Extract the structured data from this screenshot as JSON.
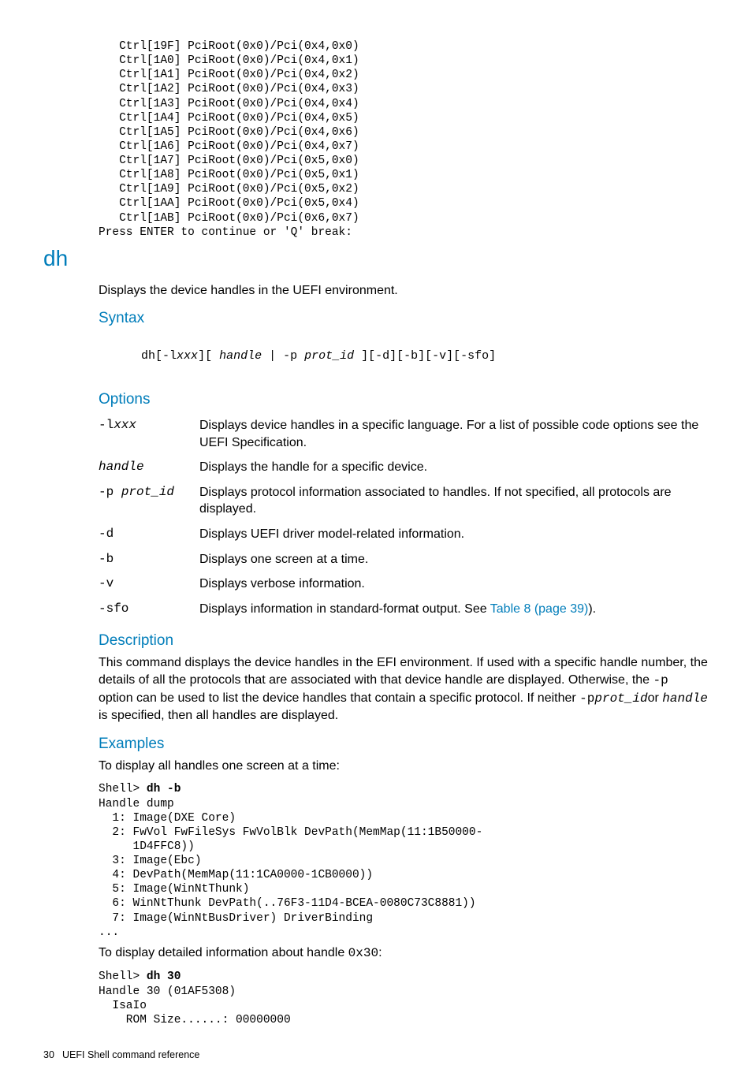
{
  "top_code": "   Ctrl[19F] PciRoot(0x0)/Pci(0x4,0x0)\n   Ctrl[1A0] PciRoot(0x0)/Pci(0x4,0x1)\n   Ctrl[1A1] PciRoot(0x0)/Pci(0x4,0x2)\n   Ctrl[1A2] PciRoot(0x0)/Pci(0x4,0x3)\n   Ctrl[1A3] PciRoot(0x0)/Pci(0x4,0x4)\n   Ctrl[1A4] PciRoot(0x0)/Pci(0x4,0x5)\n   Ctrl[1A5] PciRoot(0x0)/Pci(0x4,0x6)\n   Ctrl[1A6] PciRoot(0x0)/Pci(0x4,0x7)\n   Ctrl[1A7] PciRoot(0x0)/Pci(0x5,0x0)\n   Ctrl[1A8] PciRoot(0x0)/Pci(0x5,0x1)\n   Ctrl[1A9] PciRoot(0x0)/Pci(0x5,0x2)\n   Ctrl[1AA] PciRoot(0x0)/Pci(0x5,0x4)\n   Ctrl[1AB] PciRoot(0x0)/Pci(0x6,0x7)\nPress ENTER to continue or 'Q' break:",
  "cmd_title": "dh",
  "cmd_intro": "Displays the device handles in the UEFI environment.",
  "section": {
    "syntax": "Syntax",
    "options": "Options",
    "description": "Description",
    "examples": "Examples"
  },
  "syntax_line": {
    "pre": "dh",
    "a": "[-l",
    "xxx": "xxx",
    "b": "][ ",
    "handle": "handle",
    "c": " | -p ",
    "prot": "prot_id",
    "d": " ][-d][-b][-v][-sfo]"
  },
  "options": [
    {
      "k": "-l",
      "ki": "xxx",
      "v_pre": "Displays device handles in a specific language. For a list of possible code options see the ",
      "v_ital": "UEFI Specification",
      "v_post": "."
    },
    {
      "k": "",
      "ki": "handle",
      "v_pre": "Displays the handle for a specific device.",
      "v_ital": "",
      "v_post": ""
    },
    {
      "k": "-p ",
      "ki": "prot_id",
      "v_pre": "Displays protocol information associated to handles. If not specified, all protocols are displayed.",
      "v_ital": "",
      "v_post": ""
    },
    {
      "k": "-d",
      "ki": "",
      "v_pre": "Displays UEFI driver model-related information.",
      "v_ital": "",
      "v_post": ""
    },
    {
      "k": "-b",
      "ki": "",
      "v_pre": "Displays one screen at a time.",
      "v_ital": "",
      "v_post": ""
    },
    {
      "k": "-v",
      "ki": "",
      "v_pre": "Displays verbose information.",
      "v_ital": "",
      "v_post": ""
    },
    {
      "k": "-sfo",
      "ki": "",
      "v_pre": "Displays information in standard-format output. See ",
      "v_ital": "",
      "v_post": ").",
      "link": "Table 8 (page 39)"
    }
  ],
  "description": {
    "p1a": "This command displays the device handles in the EFI environment. If used with a specific handle number, the details of all the protocols that are associated with that device handle are displayed. Otherwise, the ",
    "p1_mono1": " -p ",
    "p1b": "option can be used to list the device handles that contain a specific protocol. If neither ",
    "p1_mono2": " -p",
    "p1_monoital": "prot_id",
    "p1c": "or ",
    "p1_monoital2": "handle",
    "p1d": " is specified, then all handles are displayed."
  },
  "examples": {
    "intro1": "To display all handles one screen at a time:",
    "code1_prompt": "Shell> ",
    "code1_bold": "dh -b",
    "code1_rest": "\nHandle dump\n  1: Image(DXE Core)\n  2: FwVol FwFileSys FwVolBlk DevPath(MemMap(11:1B50000-\n     1D4FFC8))\n  3: Image(Ebc)\n  4: DevPath(MemMap(11:1CA0000-1CB0000))\n  5: Image(WinNtThunk)\n  6: WinNtThunk DevPath(..76F3-11D4-BCEA-0080C73C8881))\n  7: Image(WinNtBusDriver) DriverBinding\n...",
    "intro2_a": "To display detailed information about handle ",
    "intro2_mono": "0x30",
    "intro2_b": ":",
    "code2_prompt": "Shell> ",
    "code2_bold": "dh 30",
    "code2_rest": "\nHandle 30 (01AF5308)\n  IsaIo\n    ROM Size......: 00000000"
  },
  "footer": {
    "page": "30",
    "title": "UEFI Shell command reference"
  }
}
